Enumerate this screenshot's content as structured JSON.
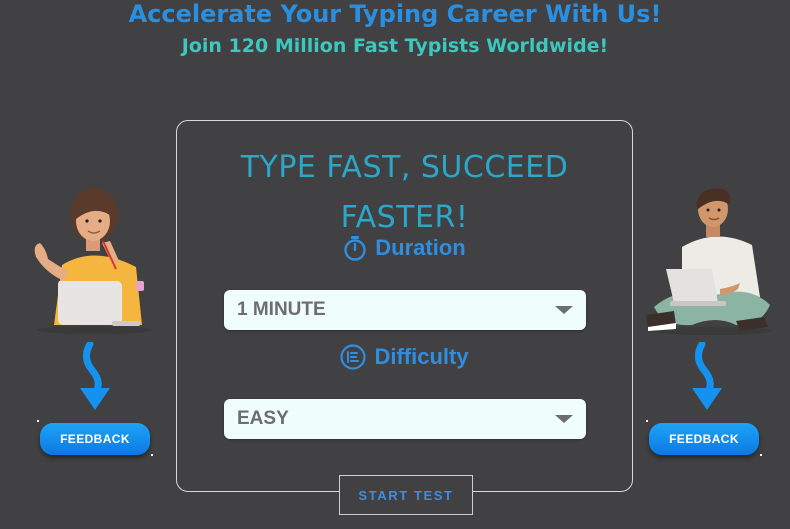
{
  "header": {
    "headline": "Accelerate Your Typing Career With Us!",
    "subheadline": "Join 120 Million Fast Typists Worldwide!"
  },
  "card": {
    "title": "TYPE FAST, SUCCEED FASTER!",
    "duration": {
      "label": "Duration",
      "icon": "stopwatch-icon",
      "selected": "1 MINUTE"
    },
    "difficulty": {
      "label": "Difficulty",
      "icon": "list-circle-icon",
      "selected": "EASY"
    },
    "start_label": "START TEST"
  },
  "feedback": {
    "left_label": "FEEDBACK",
    "right_label": "FEEDBACK"
  },
  "colors": {
    "background": "#414042",
    "headline": "#2b8fe0",
    "subheadline": "#3cc7bf",
    "title": "#2aa7c9",
    "accent": "#2f8ee0",
    "select_bg": "#effdfd",
    "button_blue": "#0b84ee"
  }
}
